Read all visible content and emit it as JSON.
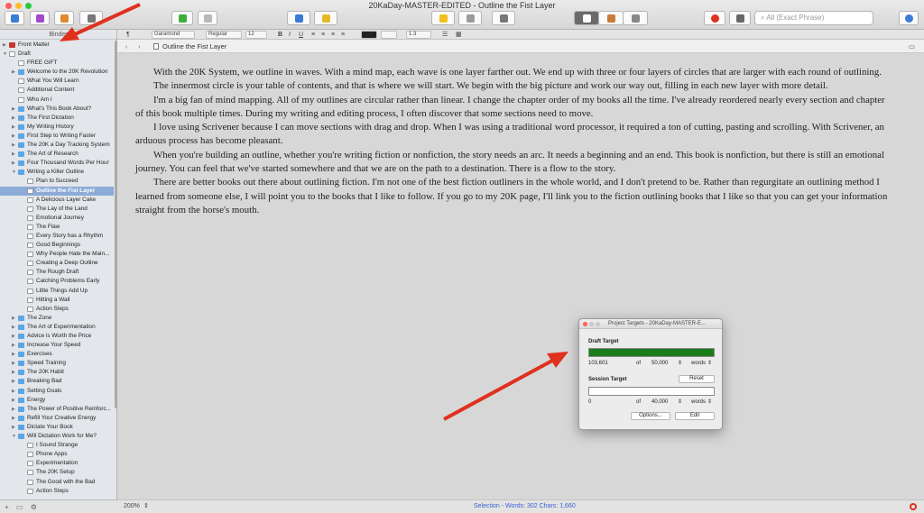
{
  "window": {
    "title": "20KaDay-MASTER-EDITED - Outline the Fist Layer"
  },
  "colors": {
    "accent_red": "#e0301e",
    "draft_bar": "#1a7d1a",
    "selection": "#8cabd6"
  },
  "toolbar": {
    "search_placeholder": "All (Exact Phrase)"
  },
  "format": {
    "font": "Garamond",
    "weight": "Regular",
    "size": "12",
    "bold": "B",
    "italic": "I",
    "underline": "U",
    "spacing": "1.3",
    "style_label": "¶"
  },
  "binder": {
    "header": "Binder",
    "items": [
      {
        "label": "Front Matter",
        "level": 0,
        "icon": "red",
        "disclosure": "closed"
      },
      {
        "label": "Draft",
        "level": 0,
        "icon": "doc",
        "disclosure": "open"
      },
      {
        "label": "FREE GIFT",
        "level": 1,
        "icon": "doc",
        "disclosure": ""
      },
      {
        "label": "Welcome to the 20K Revolution",
        "level": 1,
        "icon": "folder",
        "disclosure": "closed"
      },
      {
        "label": "What You Will Learn",
        "level": 1,
        "icon": "doc",
        "disclosure": ""
      },
      {
        "label": "Additional Content",
        "level": 1,
        "icon": "doc",
        "disclosure": ""
      },
      {
        "label": "Who Am I",
        "level": 1,
        "icon": "doc",
        "disclosure": ""
      },
      {
        "label": "What's This Book About?",
        "level": 1,
        "icon": "folder",
        "disclosure": "closed"
      },
      {
        "label": "The First Dictation",
        "level": 1,
        "icon": "folder",
        "disclosure": "closed"
      },
      {
        "label": "My Writing History",
        "level": 1,
        "icon": "folder",
        "disclosure": "closed"
      },
      {
        "label": "First Step to Writing Faster",
        "level": 1,
        "icon": "folder",
        "disclosure": "closed"
      },
      {
        "label": "The 20K a Day Tracking System",
        "level": 1,
        "icon": "folder",
        "disclosure": "closed"
      },
      {
        "label": "The Art of Research",
        "level": 1,
        "icon": "folder",
        "disclosure": "closed"
      },
      {
        "label": "Four Thousand Words Per Hour",
        "level": 1,
        "icon": "folder",
        "disclosure": "closed"
      },
      {
        "label": "Writing a Killer Outline",
        "level": 1,
        "icon": "folder",
        "disclosure": "open"
      },
      {
        "label": "Plan to Succeed",
        "level": 2,
        "icon": "doc",
        "disclosure": ""
      },
      {
        "label": "Outline the Fist Layer",
        "level": 2,
        "icon": "doc",
        "disclosure": "",
        "selected": true
      },
      {
        "label": "A Delicious Layer Cake",
        "level": 2,
        "icon": "doc",
        "disclosure": ""
      },
      {
        "label": "The Lay of the Land",
        "level": 2,
        "icon": "doc",
        "disclosure": ""
      },
      {
        "label": "Emotional Journey",
        "level": 2,
        "icon": "doc",
        "disclosure": ""
      },
      {
        "label": "The Flaw",
        "level": 2,
        "icon": "doc",
        "disclosure": ""
      },
      {
        "label": "Every Story has a Rhythm",
        "level": 2,
        "icon": "doc",
        "disclosure": ""
      },
      {
        "label": "Good Beginnings",
        "level": 2,
        "icon": "doc",
        "disclosure": ""
      },
      {
        "label": "Why People Hate the Main...",
        "level": 2,
        "icon": "doc",
        "disclosure": ""
      },
      {
        "label": "Creating a Deep Outline",
        "level": 2,
        "icon": "doc",
        "disclosure": ""
      },
      {
        "label": "The Rough Draft",
        "level": 2,
        "icon": "doc",
        "disclosure": ""
      },
      {
        "label": "Catching Problems Early",
        "level": 2,
        "icon": "doc",
        "disclosure": ""
      },
      {
        "label": "Little Things Add Up",
        "level": 2,
        "icon": "doc",
        "disclosure": ""
      },
      {
        "label": "Hitting a Wall",
        "level": 2,
        "icon": "doc",
        "disclosure": ""
      },
      {
        "label": "Action Steps",
        "level": 2,
        "icon": "doc",
        "disclosure": ""
      },
      {
        "label": "The Zone",
        "level": 1,
        "icon": "folder",
        "disclosure": "closed"
      },
      {
        "label": "The Art of Experimentation",
        "level": 1,
        "icon": "folder",
        "disclosure": "closed"
      },
      {
        "label": "Advice is Worth the Price",
        "level": 1,
        "icon": "folder",
        "disclosure": "closed"
      },
      {
        "label": "Increase Your Speed",
        "level": 1,
        "icon": "folder",
        "disclosure": "closed"
      },
      {
        "label": "Exercises",
        "level": 1,
        "icon": "folder",
        "disclosure": "closed"
      },
      {
        "label": "Speed Training",
        "level": 1,
        "icon": "folder",
        "disclosure": "closed"
      },
      {
        "label": "The 20K Habit",
        "level": 1,
        "icon": "folder",
        "disclosure": "closed"
      },
      {
        "label": "Breaking Bad",
        "level": 1,
        "icon": "folder",
        "disclosure": "closed"
      },
      {
        "label": "Setting Goals",
        "level": 1,
        "icon": "folder",
        "disclosure": "closed"
      },
      {
        "label": "Energy",
        "level": 1,
        "icon": "folder",
        "disclosure": "closed"
      },
      {
        "label": "The Power of Positive Reinforc...",
        "level": 1,
        "icon": "folder",
        "disclosure": "closed"
      },
      {
        "label": "Refill Your Creative Energy",
        "level": 1,
        "icon": "folder",
        "disclosure": "closed"
      },
      {
        "label": "Dictate Your Book",
        "level": 1,
        "icon": "folder",
        "disclosure": "closed"
      },
      {
        "label": "Will Dictation Work for Me?",
        "level": 1,
        "icon": "folder",
        "disclosure": "open"
      },
      {
        "label": "I Sound Strange",
        "level": 2,
        "icon": "doc",
        "disclosure": ""
      },
      {
        "label": "Phone Apps",
        "level": 2,
        "icon": "doc",
        "disclosure": ""
      },
      {
        "label": "Experimentation",
        "level": 2,
        "icon": "doc",
        "disclosure": ""
      },
      {
        "label": "The 20K Setup",
        "level": 2,
        "icon": "doc",
        "disclosure": ""
      },
      {
        "label": "The Good with the Bad",
        "level": 2,
        "icon": "doc",
        "disclosure": ""
      },
      {
        "label": "Action Steps",
        "level": 2,
        "icon": "doc",
        "disclosure": ""
      }
    ],
    "footer_add": "+",
    "footer_folder": "▭",
    "footer_gear": "⚙"
  },
  "editor": {
    "header_title": "Outline the Fist Layer",
    "paragraphs": [
      "With the 20K System, we outline in waves.  With a mind map, each wave is one layer farther out.  We end up with three or four layers of circles that are larger with each round of outlining.",
      "The innermost circle is your table of contents, and that is where we will start.  We begin with the big picture and work our way out, filling in each new layer with more detail.",
      "I'm a big fan of mind mapping. All of my outlines are circular rather than linear. I change the chapter order of my books all the time.  I've already reordered nearly every section and chapter of this book multiple times.  During my writing and editing process, I often discover that some sections need to move.",
      "I love using Scrivener because I can move sections with drag and drop.  When I was using a traditional word processor, it required a ton of cutting, pasting and scrolling.  With Scrivener, an arduous process has become pleasant.",
      "When you're building an outline, whether you're writing fiction or nonfiction, the story needs an arc. It needs a beginning and an end. This book is nonfiction, but there is still an emotional journey.  You can feel that we've started somewhere and that we are on the path to a destination.  There is a flow to the story.",
      "There are better books out there about outlining fiction. I'm not one of the best fiction outliners in the whole world, and I don't pretend to be.  Rather than regurgitate an outlining method I learned from someone else, I will point you to the books that I like to follow. If you go to my 20K page, I'll link you to the fiction outlining books that I like so that you can get your information straight from the horse's mouth."
    ]
  },
  "status": {
    "zoom": "200%",
    "selection": "Selection - Words: 302   Chars: 1,660"
  },
  "targets": {
    "title": "Project Targets - 20KaDay-MASTER-E...",
    "draft_label": "Draft Target",
    "draft_count": "103,601",
    "of": "of",
    "draft_goal": "50,000",
    "unit": "words",
    "draft_progress": 1.0,
    "session_label": "Session Target",
    "reset": "Reset",
    "session_count": "0",
    "session_goal": "40,000",
    "session_progress": 0.0,
    "options": "Options...",
    "edit": "Edit"
  }
}
